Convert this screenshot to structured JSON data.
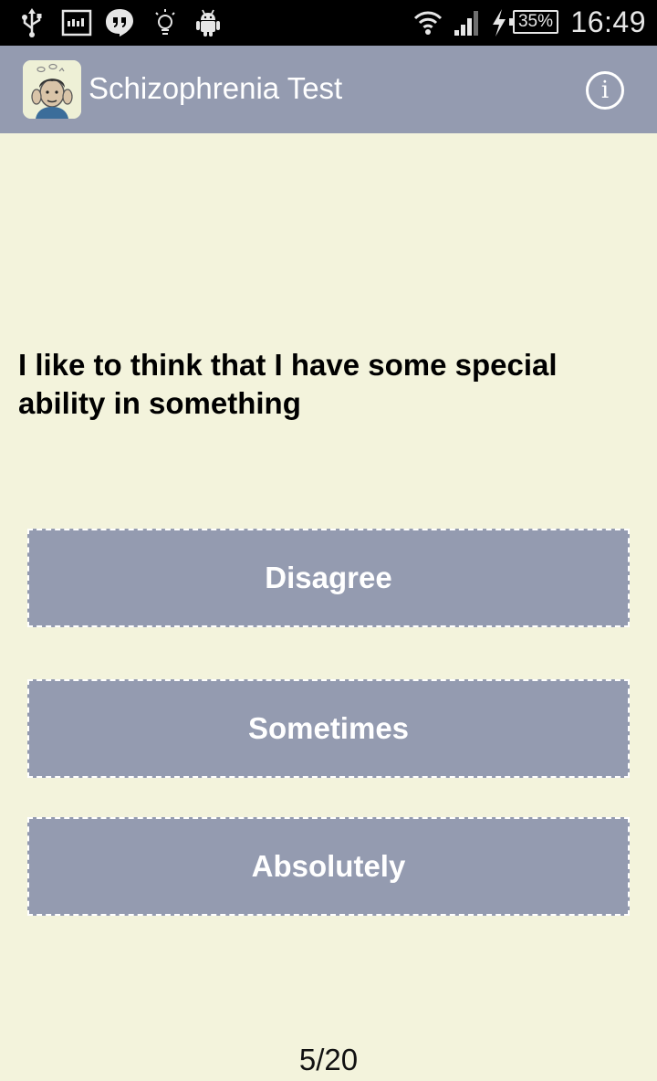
{
  "status_bar": {
    "icons": [
      "usb-icon",
      "signal-meter-icon",
      "hangouts-icon",
      "lightbulb-icon",
      "android-icon",
      "wifi-icon",
      "cell-signal-icon",
      "charging-icon",
      "battery-icon"
    ],
    "battery_percent": "35%",
    "time": "16:49"
  },
  "action_bar": {
    "title": "Schizophrenia Test",
    "info_icon_glyph": "i",
    "background_color": "#949bb0"
  },
  "question": {
    "text": "I like to think that I have some special ability in something"
  },
  "answers": [
    {
      "label": "Disagree"
    },
    {
      "label": "Sometimes"
    },
    {
      "label": "Absolutely"
    }
  ],
  "progress": {
    "text": "5/20"
  },
  "colors": {
    "background": "#f3f3dc",
    "accent": "#949bb0",
    "button_text": "#ffffff"
  }
}
